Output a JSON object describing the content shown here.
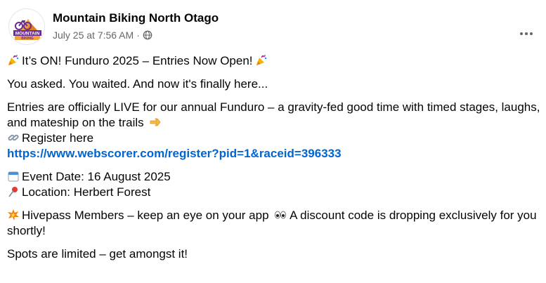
{
  "post": {
    "page_name": "Mountain Biking North Otago",
    "timestamp": "July 25 at 7:56 AM",
    "separator": "·",
    "avatar_logo_text": [
      "MOUNTAIN",
      "BIKING",
      "NORTH OTAGO"
    ],
    "headline": "It’s ON! Funduro 2025 – Entries Now Open!",
    "line_asked": "You asked. You waited. And now it's finally here...",
    "entries_text": "Entries are officially LIVE for our annual Funduro – a gravity-fed good time with timed stages, laughs, and mateship on the trails",
    "register_label": "Register here",
    "register_link": "https://www.webscorer.com/register?pid=1&raceid=396333",
    "event_date": "Event Date: 16 August 2025",
    "location": "Location: Herbert Forest",
    "hivepass_part1": "Hivepass Members – keep an eye on your app",
    "hivepass_part2": "A discount code is dropping exclusively for you shortly!",
    "closing": "Spots are limited – get amongst it!"
  },
  "icons": {
    "headline_left": "party-popper-icon",
    "headline_right": "party-popper-icon",
    "entries": "pointing-right-icon",
    "register": "link-icon",
    "date": "calendar-icon",
    "location": "pushpin-icon",
    "hivepass": "collision-icon",
    "eyes": "eyes-icon",
    "privacy": "globe-icon",
    "menu": "more-options-icon"
  },
  "colors": {
    "text": "#050505",
    "secondary_text": "#65676b",
    "link": "#0064d1",
    "avatar_purple": "#6a2c91",
    "avatar_orange": "#f2a33a"
  }
}
